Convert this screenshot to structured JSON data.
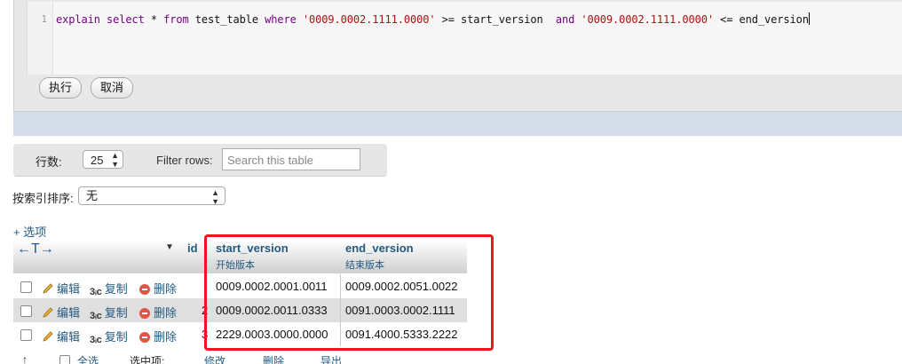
{
  "editor": {
    "line_number": "1",
    "sql": {
      "kw_explain": "explain",
      "kw_select": "select",
      "star": " * ",
      "kw_from": "from",
      "table": " test_table ",
      "kw_where": "where",
      "str1": "'0009.0002.1111.0000'",
      "op1": " >= start_version  ",
      "kw_and": "and",
      "str2": "'0009.0002.1111.0000'",
      "op2": " <= end_version"
    }
  },
  "buttons": {
    "execute": "执行",
    "cancel": "取消"
  },
  "nav": {
    "rows_label": "行数:",
    "rows_value": "25",
    "filter_label": "Filter rows:",
    "filter_placeholder": "Search this table"
  },
  "sort": {
    "label": "按索引排序:",
    "value": "无"
  },
  "options_link": "+ 选项",
  "table": {
    "arrows": "←T→",
    "id_header": "id",
    "columns": [
      {
        "name": "start_version",
        "comment": "开始版本"
      },
      {
        "name": "end_version",
        "comment": "结束版本"
      }
    ],
    "actions": {
      "edit": "编辑",
      "copy": "复制",
      "delete": "删除"
    },
    "rows": [
      {
        "id_fragment": "",
        "start_version": "0009.0002.0001.0011",
        "end_version": "0009.0002.0051.0022"
      },
      {
        "id_fragment": "2",
        "start_version": "0009.0002.0011.0333",
        "end_version": "0091.0003.0002.1111"
      },
      {
        "id_fragment": "3",
        "start_version": "2229.0003.0000.0000",
        "end_version": "0091.4000.5333.2222"
      }
    ]
  },
  "bottom": {
    "check_all": "全选",
    "with_selected": "选中项:",
    "edit": "修改",
    "delete": "删除",
    "export": "导出"
  }
}
